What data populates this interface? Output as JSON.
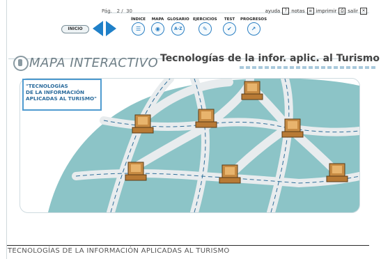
{
  "top": {
    "page_label": "Pág.",
    "page_current": "2",
    "page_sep": "/",
    "page_total": "30",
    "ayuda": "ayuda",
    "notas": "notas",
    "imprimir": "imprimir",
    "salir": "salir"
  },
  "nav": {
    "inicio": "INICIO",
    "items": [
      {
        "label": "ÍNDICE",
        "glyph": "☰"
      },
      {
        "label": "MAPA",
        "glyph": "◉"
      },
      {
        "label": "GLOSARIO",
        "glyph": "A-Z"
      },
      {
        "label": "EJERCICIOS",
        "glyph": "✎"
      },
      {
        "label": "TEST",
        "glyph": "✔"
      },
      {
        "label": "PROGRESOS",
        "glyph": "↗"
      }
    ]
  },
  "header": {
    "map_title": "MAPA INTERACTIVO",
    "subject": "Tecnologías de la infor. aplic. al Turismo"
  },
  "callout": {
    "lines": [
      "\"TECNOLOGÍAS",
      "DE LA INFORMACIÓN",
      "APLICADAS AL TURISMO\""
    ]
  },
  "footer": {
    "text": "TECNOLOGÍAS DE LA INFORMACIÓN APLICADAS AL TURISMO"
  },
  "colors": {
    "accent": "#1f80c8",
    "map_bg": "#8cc4c7",
    "road": "#eef1f2"
  }
}
